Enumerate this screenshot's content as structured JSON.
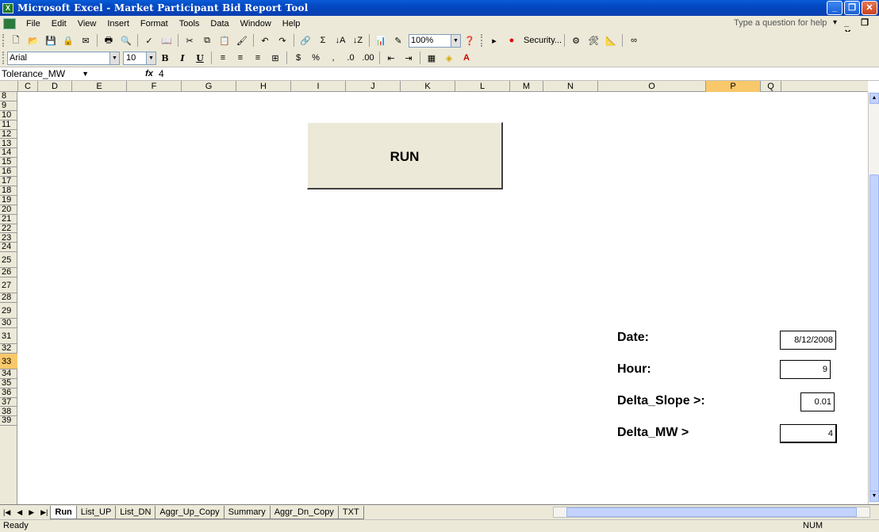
{
  "window": {
    "title": "Microsoft Excel - Market Participant Bid Report Tool",
    "icon": "excel-icon",
    "buttons": [
      "minimize",
      "restore",
      "close"
    ]
  },
  "menu": {
    "items": [
      "File",
      "Edit",
      "View",
      "Insert",
      "Format",
      "Tools",
      "Data",
      "Window",
      "Help"
    ],
    "help_placeholder": "Type a question for help"
  },
  "toolbar": {
    "zoom": "100%",
    "security": "Security...",
    "font": "Arial",
    "font_size": "10"
  },
  "formula_bar": {
    "name_box": "Tolerance_MW",
    "fx": "fx",
    "value": "4"
  },
  "columns": [
    "C",
    "D",
    "E",
    "F",
    "G",
    "H",
    "I",
    "J",
    "K",
    "L",
    "M",
    "N",
    "O",
    "P",
    "Q"
  ],
  "selected_column": "P",
  "rows": [
    "8",
    "9",
    "10",
    "11",
    "12",
    "13",
    "14",
    "15",
    "16",
    "17",
    "18",
    "19",
    "20",
    "21",
    "22",
    "23",
    "24",
    "25",
    "26",
    "27",
    "28",
    "29",
    "30",
    "31",
    "32",
    "33",
    "34",
    "35",
    "36",
    "37",
    "38",
    "39"
  ],
  "selected_row": "33",
  "sheet": {
    "run_button": "RUN",
    "fields": [
      {
        "label": "Date:",
        "value": "8/12/2008"
      },
      {
        "label": "Hour:",
        "value": "9"
      },
      {
        "label": "Delta_Slope >:",
        "value": "0.01"
      },
      {
        "label": "Delta_MW >",
        "value": "4"
      }
    ]
  },
  "tabs": [
    "Run",
    "List_UP",
    "List_DN",
    "Aggr_Up_Copy",
    "Summary",
    "Aggr_Dn_Copy",
    "TXT"
  ],
  "active_tab": "Run",
  "status": {
    "text": "Ready",
    "num": "NUM"
  }
}
